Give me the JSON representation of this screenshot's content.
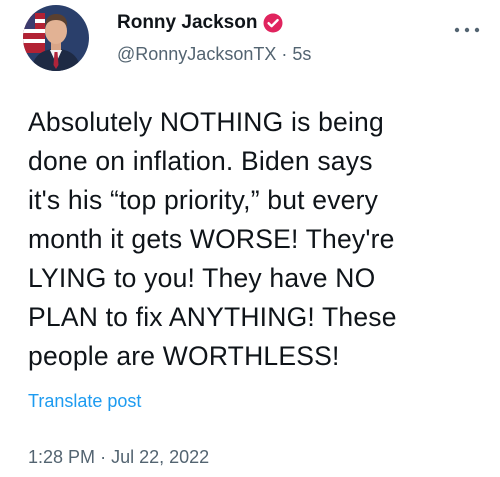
{
  "author": {
    "display_name": "Ronny Jackson",
    "handle": "@RonnyJacksonTX",
    "separator": "·",
    "relative_time": "5s"
  },
  "post": {
    "text_lines": [
      "Absolutely NOTHING is being",
      "done on inflation. Biden says",
      "it's his “top priority,” but every",
      "month it gets WORSE! They're",
      "LYING to you! They have NO",
      "PLAN to fix ANYTHING! These",
      "people are WORTHLESS!"
    ],
    "translate_label": "Translate post"
  },
  "meta": {
    "time": "1:28 PM",
    "separator": "·",
    "date": "Jul 22, 2022"
  },
  "icons": {
    "verified": "verified-badge-icon",
    "more": "more-options-icon"
  },
  "colors": {
    "text": "#0f1419",
    "secondary": "#536471",
    "link": "#1d9bf0",
    "verified_badge": "#e0245e"
  }
}
